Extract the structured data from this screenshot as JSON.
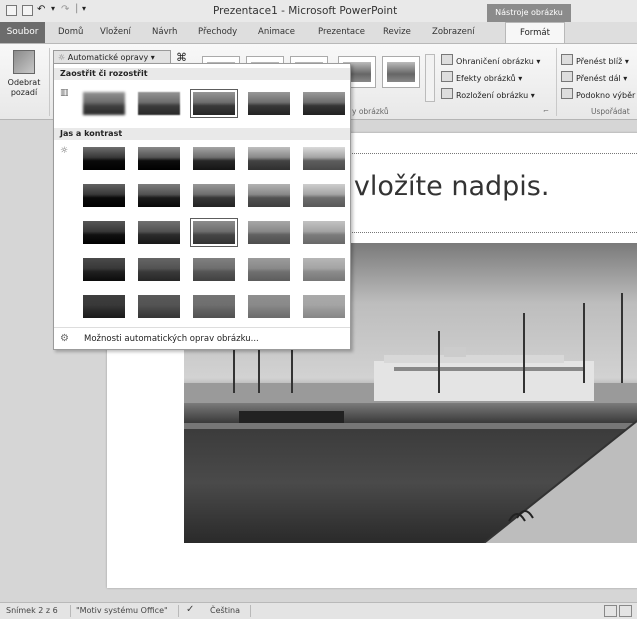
{
  "titlebar": {
    "title": "Prezentace1 - Microsoft PowerPoint",
    "context_tab": "Nástroje obrázku",
    "qat_separator": "|"
  },
  "tabs": [
    {
      "label": "Soubor"
    },
    {
      "label": "Domů"
    },
    {
      "label": "Vložení"
    },
    {
      "label": "Návrh"
    },
    {
      "label": "Přechody"
    },
    {
      "label": "Animace"
    },
    {
      "label": "Prezentace"
    },
    {
      "label": "Revize"
    },
    {
      "label": "Zobrazení"
    },
    {
      "label": "Formát"
    }
  ],
  "ribbon": {
    "remove_bg_line1": "Odebrat",
    "remove_bg_line2": "pozadí",
    "corrections_label": "Automatické opravy ▾",
    "picture_border": "Ohraničení obrázku ▾",
    "picture_effects": "Efekty obrázků ▾",
    "picture_layout": "Rozložení obrázku ▾",
    "bring_forward": "Přenést blíž ▾",
    "send_backward": "Přenést dál ▾",
    "selection_pane": "Podokno výběr",
    "group_styles": "y obrázků",
    "group_arrange": "Uspořádat"
  },
  "dropdown": {
    "section1_title": "Zaostřit či rozostřit",
    "section2_title": "Jas a kontrast",
    "footer": "Možnosti automatických oprav obrázku...",
    "sharpen_selected_index": 2,
    "brightness_selected": [
      2,
      2
    ]
  },
  "slide": {
    "title_text": "m vložíte nadpis."
  },
  "statusbar": {
    "slide_info": "Snímek 2 z 6",
    "theme": "\"Motiv systému Office\"",
    "language": "Čeština"
  }
}
